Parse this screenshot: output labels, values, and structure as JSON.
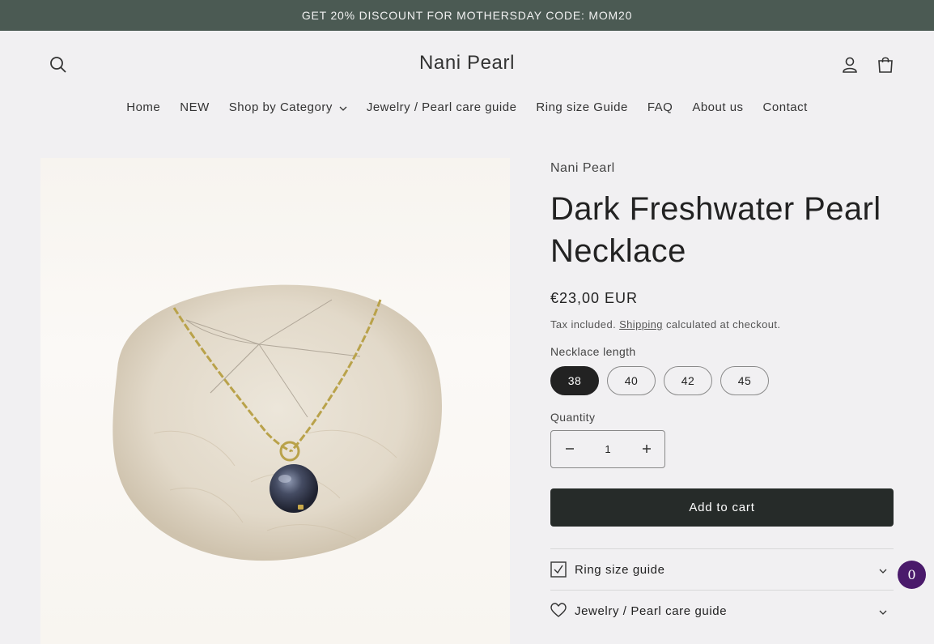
{
  "announcement": "GET 20% DISCOUNT FOR MOTHERSDAY CODE: MOM20",
  "header": {
    "logo": "Nani Pearl",
    "nav": [
      "Home",
      "NEW",
      "Shop by Category",
      "Jewelry / Pearl care guide",
      "Ring size Guide",
      "FAQ",
      "About us",
      "Contact"
    ]
  },
  "product": {
    "vendor": "Nani Pearl",
    "title": "Dark Freshwater Pearl Necklace",
    "price": "€23,00 EUR",
    "tax_prefix": "Tax included.",
    "tax_link": "Shipping",
    "tax_suffix": "calculated at checkout.",
    "option_label": "Necklace length",
    "options": [
      "38",
      "40",
      "42",
      "45"
    ],
    "selected_option": "38",
    "quantity_label": "Quantity",
    "quantity": "1",
    "add_to_cart": "Add to cart"
  },
  "accordions": {
    "ring_size": "Ring size guide",
    "care": "Jewelry / Pearl care guide"
  },
  "chat_badge": "0",
  "colors": {
    "announcement_bg": "#4b5a53",
    "button_bg": "#262b29",
    "badge_bg": "#4a1a6b"
  }
}
